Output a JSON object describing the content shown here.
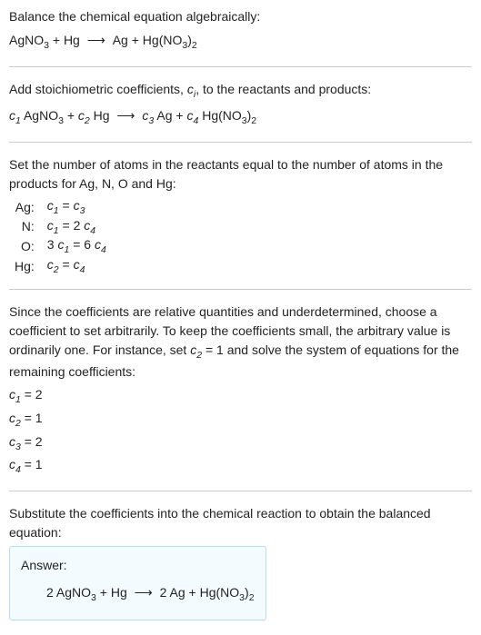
{
  "intro": {
    "line1": "Balance the chemical equation algebraically:"
  },
  "eq1": {
    "lhs1": "AgNO",
    "lhs1_sub": "3",
    "plus1": " + ",
    "lhs2": "Hg",
    "arrow": " ⟶ ",
    "rhs1": "Ag",
    "plus2": " + ",
    "rhs2": "Hg(NO",
    "rhs2_sub1": "3",
    "rhs2_paren": ")",
    "rhs2_sub2": "2"
  },
  "step2": {
    "text": "Add stoichiometric coefficients, ",
    "ci": "c",
    "ci_sub": "i",
    "text2": ", to the reactants and products:"
  },
  "eq2": {
    "c1": "c",
    "c1s": "1",
    "sp1": " AgNO",
    "sp1s": "3",
    "plus1": " + ",
    "c2": "c",
    "c2s": "2",
    "sp2": " Hg",
    "arrow": " ⟶ ",
    "c3": "c",
    "c3s": "3",
    "sp3": " Ag",
    "plus2": " + ",
    "c4": "c",
    "c4s": "4",
    "sp4": " Hg(NO",
    "sp4s1": "3",
    "sp4p": ")",
    "sp4s2": "2"
  },
  "step3": {
    "text": "Set the number of atoms in the reactants equal to the number of atoms in the products for Ag, N, O and Hg:"
  },
  "atoms": {
    "r1": {
      "el": "Ag:",
      "c_a": "c",
      "c_as": "1",
      "eq": " = ",
      "c_b": "c",
      "c_bs": "3"
    },
    "r2": {
      "el": "N:",
      "c_a": "c",
      "c_as": "1",
      "eq": " = 2 ",
      "c_b": "c",
      "c_bs": "4"
    },
    "r3": {
      "el": "O:",
      "pre": "3 ",
      "c_a": "c",
      "c_as": "1",
      "eq": " = 6 ",
      "c_b": "c",
      "c_bs": "4"
    },
    "r4": {
      "el": "Hg:",
      "c_a": "c",
      "c_as": "2",
      "eq": " = ",
      "c_b": "c",
      "c_bs": "4"
    }
  },
  "step4": {
    "text1": "Since the coefficients are relative quantities and underdetermined, choose a coefficient to set arbitrarily. To keep the coefficients small, the arbitrary value is ordinarily one. For instance, set ",
    "cv": "c",
    "cvs": "2",
    "text2": " = 1 and solve the system of equations for the remaining coefficients:"
  },
  "coefs": {
    "r1": {
      "c": "c",
      "cs": "1",
      "val": " = 2"
    },
    "r2": {
      "c": "c",
      "cs": "2",
      "val": " = 1"
    },
    "r3": {
      "c": "c",
      "cs": "3",
      "val": " = 2"
    },
    "r4": {
      "c": "c",
      "cs": "4",
      "val": " = 1"
    }
  },
  "step5": {
    "text": "Substitute the coefficients into the chemical reaction to obtain the balanced equation:"
  },
  "answer": {
    "label": "Answer:",
    "lhs1a": "2 AgNO",
    "lhs1s": "3",
    "plus1": " + ",
    "lhs2": "Hg",
    "arrow": " ⟶ ",
    "rhs1": "2 Ag",
    "plus2": " + ",
    "rhs2a": "Hg(NO",
    "rhs2s1": "3",
    "rhs2p": ")",
    "rhs2s2": "2"
  }
}
